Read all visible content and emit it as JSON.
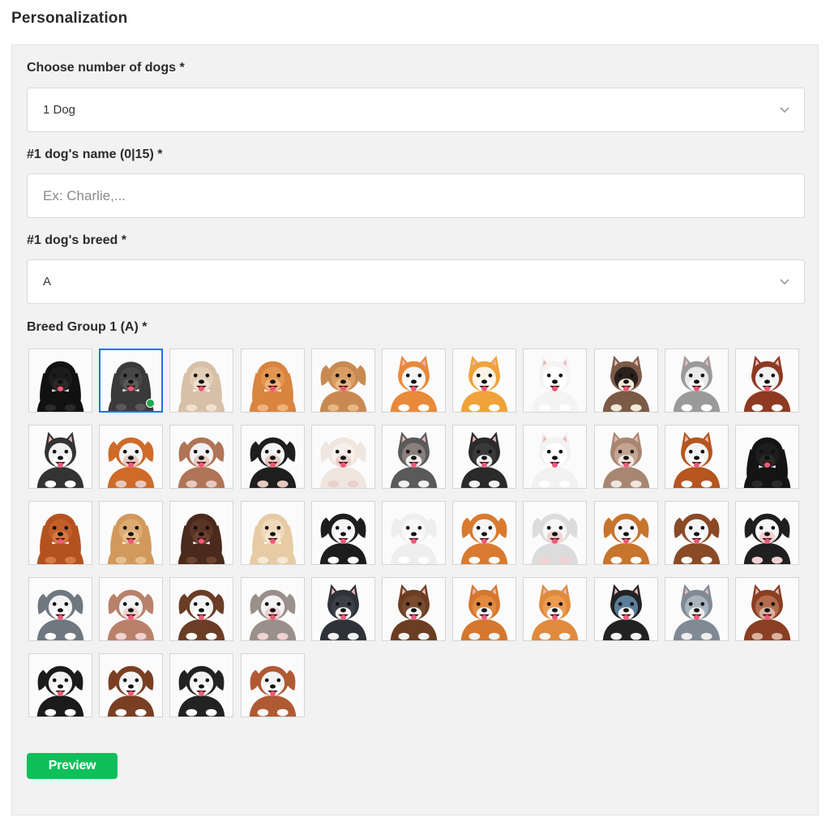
{
  "title": "Personalization",
  "form": {
    "count_label": "Choose number of dogs *",
    "count_value": "1 Dog",
    "name_label": "#1 dog's name (0|15) *",
    "name_placeholder": "Ex: Charlie,...",
    "name_value": "",
    "breed_label": "#1 dog's breed *",
    "breed_value": "A",
    "group_label": "Breed Group 1 (A) *",
    "preview_label": "Preview"
  },
  "breed_tiles": [
    {
      "fur": "#111111",
      "face": "#1c1c1c",
      "muzzle": "#2a2a2a",
      "ears": "long",
      "selected": false
    },
    {
      "fur": "#3a3a3a",
      "face": "#474747",
      "muzzle": "#5a5a5a",
      "ears": "long",
      "selected": true
    },
    {
      "fur": "#d8c0a8",
      "face": "#e2cdb7",
      "muzzle": "#efe0cf",
      "ears": "long",
      "selected": false
    },
    {
      "fur": "#d9843f",
      "face": "#e39651",
      "muzzle": "#efb27a",
      "ears": "long",
      "selected": false
    },
    {
      "fur": "#c98a52",
      "face": "#d99d63",
      "muzzle": "#e9b784",
      "ears": "floppy",
      "selected": false
    },
    {
      "fur": "#e9893a",
      "face": "#f5f5f5",
      "muzzle": "#ffffff",
      "ears": "pointy",
      "selected": false
    },
    {
      "fur": "#f0a23a",
      "face": "#fbf3e6",
      "muzzle": "#ffffff",
      "ears": "pointy",
      "selected": false
    },
    {
      "fur": "#f4f4f4",
      "face": "#ffffff",
      "muzzle": "#ffffff",
      "ears": "pointy",
      "selected": false
    },
    {
      "fur": "#7b5a46",
      "face": "#2a211d",
      "muzzle": "#f1ead9",
      "ears": "pointy",
      "selected": false
    },
    {
      "fur": "#9a9a9a",
      "face": "#e9e9e9",
      "muzzle": "#ffffff",
      "ears": "pointy",
      "selected": false
    },
    {
      "fur": "#8e3a22",
      "face": "#f1f1f1",
      "muzzle": "#ffffff",
      "ears": "pointy",
      "selected": false
    },
    {
      "fur": "#333333",
      "face": "#f1f1f1",
      "muzzle": "#ffffff",
      "ears": "pointy",
      "selected": false
    },
    {
      "fur": "#d06a28",
      "face": "#f5f5f5",
      "muzzle": "#e7c9c0",
      "ears": "floppy",
      "selected": false
    },
    {
      "fur": "#b07456",
      "face": "#f2f2f2",
      "muzzle": "#e7c9c0",
      "ears": "floppy",
      "selected": false
    },
    {
      "fur": "#1e1e1e",
      "face": "#f3f3f3",
      "muzzle": "#e7c9c0",
      "ears": "floppy",
      "selected": false
    },
    {
      "fur": "#efe6e0",
      "face": "#f7f1ec",
      "muzzle": "#ead1cc",
      "ears": "floppy",
      "selected": false
    },
    {
      "fur": "#5a5a5a",
      "face": "#8a7f7a",
      "muzzle": "#f1f1f1",
      "ears": "pointy",
      "selected": false
    },
    {
      "fur": "#2a2a2a",
      "face": "#3a3a3a",
      "muzzle": "#f1f1f1",
      "ears": "pointy",
      "selected": false
    },
    {
      "fur": "#f2f2f2",
      "face": "#ffffff",
      "muzzle": "#ffffff",
      "ears": "pointy",
      "selected": false
    },
    {
      "fur": "#a98672",
      "face": "#c4a593",
      "muzzle": "#f0e6e0",
      "ears": "pointy",
      "selected": false
    },
    {
      "fur": "#b5551f",
      "face": "#f3f3f3",
      "muzzle": "#ffffff",
      "ears": "pointy",
      "selected": false
    },
    {
      "fur": "#141414",
      "face": "#1d1d1d",
      "muzzle": "#2a2a2a",
      "ears": "long",
      "selected": false
    },
    {
      "fur": "#b4521f",
      "face": "#c25f28",
      "muzzle": "#d67a44",
      "ears": "long",
      "selected": false
    },
    {
      "fur": "#d2995d",
      "face": "#ddaa70",
      "muzzle": "#e8c08f",
      "ears": "long",
      "selected": false
    },
    {
      "fur": "#4a2a1c",
      "face": "#5a3424",
      "muzzle": "#6e4230",
      "ears": "long",
      "selected": false
    },
    {
      "fur": "#e6cba4",
      "face": "#efd9b9",
      "muzzle": "#f6e8d2",
      "ears": "long",
      "selected": false
    },
    {
      "fur": "#1d1d1d",
      "face": "#f4f4f4",
      "muzzle": "#ffffff",
      "ears": "floppy",
      "selected": false
    },
    {
      "fur": "#eeeeee",
      "face": "#f8f8f8",
      "muzzle": "#ffffff",
      "ears": "floppy",
      "selected": false
    },
    {
      "fur": "#d97a30",
      "face": "#f5f5f5",
      "muzzle": "#ffffff",
      "ears": "floppy",
      "selected": false
    },
    {
      "fur": "#dcdcdc",
      "face": "#f7f7f7",
      "muzzle": "#f0d2d2",
      "ears": "floppy",
      "selected": false
    },
    {
      "fur": "#c7742c",
      "face": "#f5f5f5",
      "muzzle": "#ffffff",
      "ears": "floppy",
      "selected": false
    },
    {
      "fur": "#8a4a26",
      "face": "#f5f5f5",
      "muzzle": "#ffffff",
      "ears": "floppy",
      "selected": false
    },
    {
      "fur": "#1f1f1f",
      "face": "#f5f5f5",
      "muzzle": "#f0d2d2",
      "ears": "floppy",
      "selected": false
    },
    {
      "fur": "#6f7780",
      "face": "#f3f3f3",
      "muzzle": "#ffffff",
      "ears": "floppy",
      "selected": false
    },
    {
      "fur": "#b9816a",
      "face": "#f3f3f3",
      "muzzle": "#f0d2d2",
      "ears": "floppy",
      "selected": false
    },
    {
      "fur": "#6b3d25",
      "face": "#f3f3f3",
      "muzzle": "#ffffff",
      "ears": "floppy",
      "selected": false
    },
    {
      "fur": "#9a8f8a",
      "face": "#f3f3f3",
      "muzzle": "#f0d2d2",
      "ears": "floppy",
      "selected": false
    },
    {
      "fur": "#2f3338",
      "face": "#3b4047",
      "muzzle": "#f3f3f3",
      "ears": "pointy",
      "selected": false
    },
    {
      "fur": "#6b3d22",
      "face": "#7a4a2c",
      "muzzle": "#f3f3f3",
      "ears": "pointy",
      "selected": false
    },
    {
      "fur": "#d5772e",
      "face": "#e28a3f",
      "muzzle": "#f3f3f3",
      "ears": "pointy",
      "selected": false
    },
    {
      "fur": "#e08a3d",
      "face": "#ec9b50",
      "muzzle": "#f6f6f6",
      "ears": "pointy",
      "selected": false
    },
    {
      "fur": "#222222",
      "face": "#5a7d9a",
      "muzzle": "#f3f3f3",
      "ears": "pointy",
      "selected": false
    },
    {
      "fur": "#7f8a94",
      "face": "#a9b3bc",
      "muzzle": "#eeeeee",
      "ears": "pointy",
      "selected": false
    },
    {
      "fur": "#8a3f22",
      "face": "#b36b4b",
      "muzzle": "#d9b2a0",
      "ears": "pointy",
      "selected": false
    },
    {
      "fur": "#1b1b1b",
      "face": "#f3f3f3",
      "muzzle": "#ffffff",
      "ears": "floppy",
      "selected": false
    },
    {
      "fur": "#7a3f22",
      "face": "#f3f3f3",
      "muzzle": "#ffffff",
      "ears": "floppy",
      "selected": false
    },
    {
      "fur": "#222222",
      "face": "#f3f3f3",
      "muzzle": "#ffffff",
      "ears": "floppy",
      "selected": false
    },
    {
      "fur": "#b05a33",
      "face": "#f3f3f3",
      "muzzle": "#ffffff",
      "ears": "floppy",
      "selected": false
    }
  ]
}
